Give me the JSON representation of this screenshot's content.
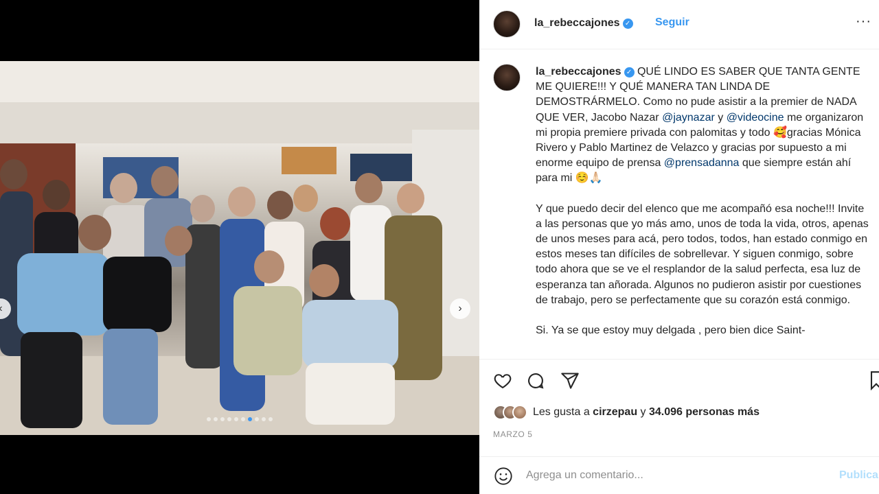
{
  "post": {
    "username": "la_rebeccajones",
    "follow_label": "Seguir",
    "more_label": "···",
    "caption_paragraphs": [
      {
        "segments": [
          {
            "t": "QUÉ LINDO ES SABER QUE TANTA GENTE ME QUIERE!!! Y QUÉ MANERA TAN LINDA DE DEMOSTRÁRMELO. Como no pude asistir a la premier de NADA QUE VER, Jacobo Nazar ",
            "m": false
          },
          {
            "t": "@jaynazar",
            "m": true
          },
          {
            "t": " y ",
            "m": false
          },
          {
            "t": "@videocine",
            "m": true
          },
          {
            "t": " me organizaron mi propia premiere privada con palomitas y todo 🥰gracias Mónica Rivero y Pablo Martinez de Velazco y gracias por supuesto a mi enorme equipo de prensa ",
            "m": false
          },
          {
            "t": "@prensadanna",
            "m": true
          },
          {
            "t": " que siempre están ahí para mi ☺️🙏🏻",
            "m": false
          }
        ]
      },
      {
        "segments": [
          {
            "t": "Y que puedo decir del elenco que me acompañó esa noche!!! Invite a las personas que yo más amo, unos de toda la vida, otros, apenas de unos meses para acá, pero todos, todos, han estado conmigo en estos meses tan difíciles de sobrellevar. Y siguen conmigo, sobre todo ahora que se ve el resplandor de la salud perfecta, esa luz de esperanza tan añorada. Algunos no pudieron asistir por cuestiones de trabajo, pero se perfectamente que su corazón está conmigo.",
            "m": false
          }
        ]
      },
      {
        "segments": [
          {
            "t": "Si. Ya se que estoy muy delgada , pero bien dice Saint-",
            "m": false
          }
        ]
      }
    ],
    "likes": {
      "prefix": "Les gusta a ",
      "first_user": "cirzepau",
      "middle": " y ",
      "count_text": "34.096 personas más"
    },
    "date": "MARZO 5",
    "comment_placeholder": "Agrega un comentario...",
    "publish_label": "Publica",
    "carousel": {
      "total_slides": 10,
      "active_index": 6
    }
  },
  "colors": {
    "accent_blue": "#3897f0",
    "mention": "#00376b",
    "muted": "#8e8e8e",
    "publish_disabled": "#b2dffc"
  },
  "icons": [
    "heart-icon",
    "comment-icon",
    "share-icon",
    "bookmark-icon",
    "emoji-icon",
    "verified-icon",
    "chevron-left-icon",
    "chevron-right-icon"
  ]
}
